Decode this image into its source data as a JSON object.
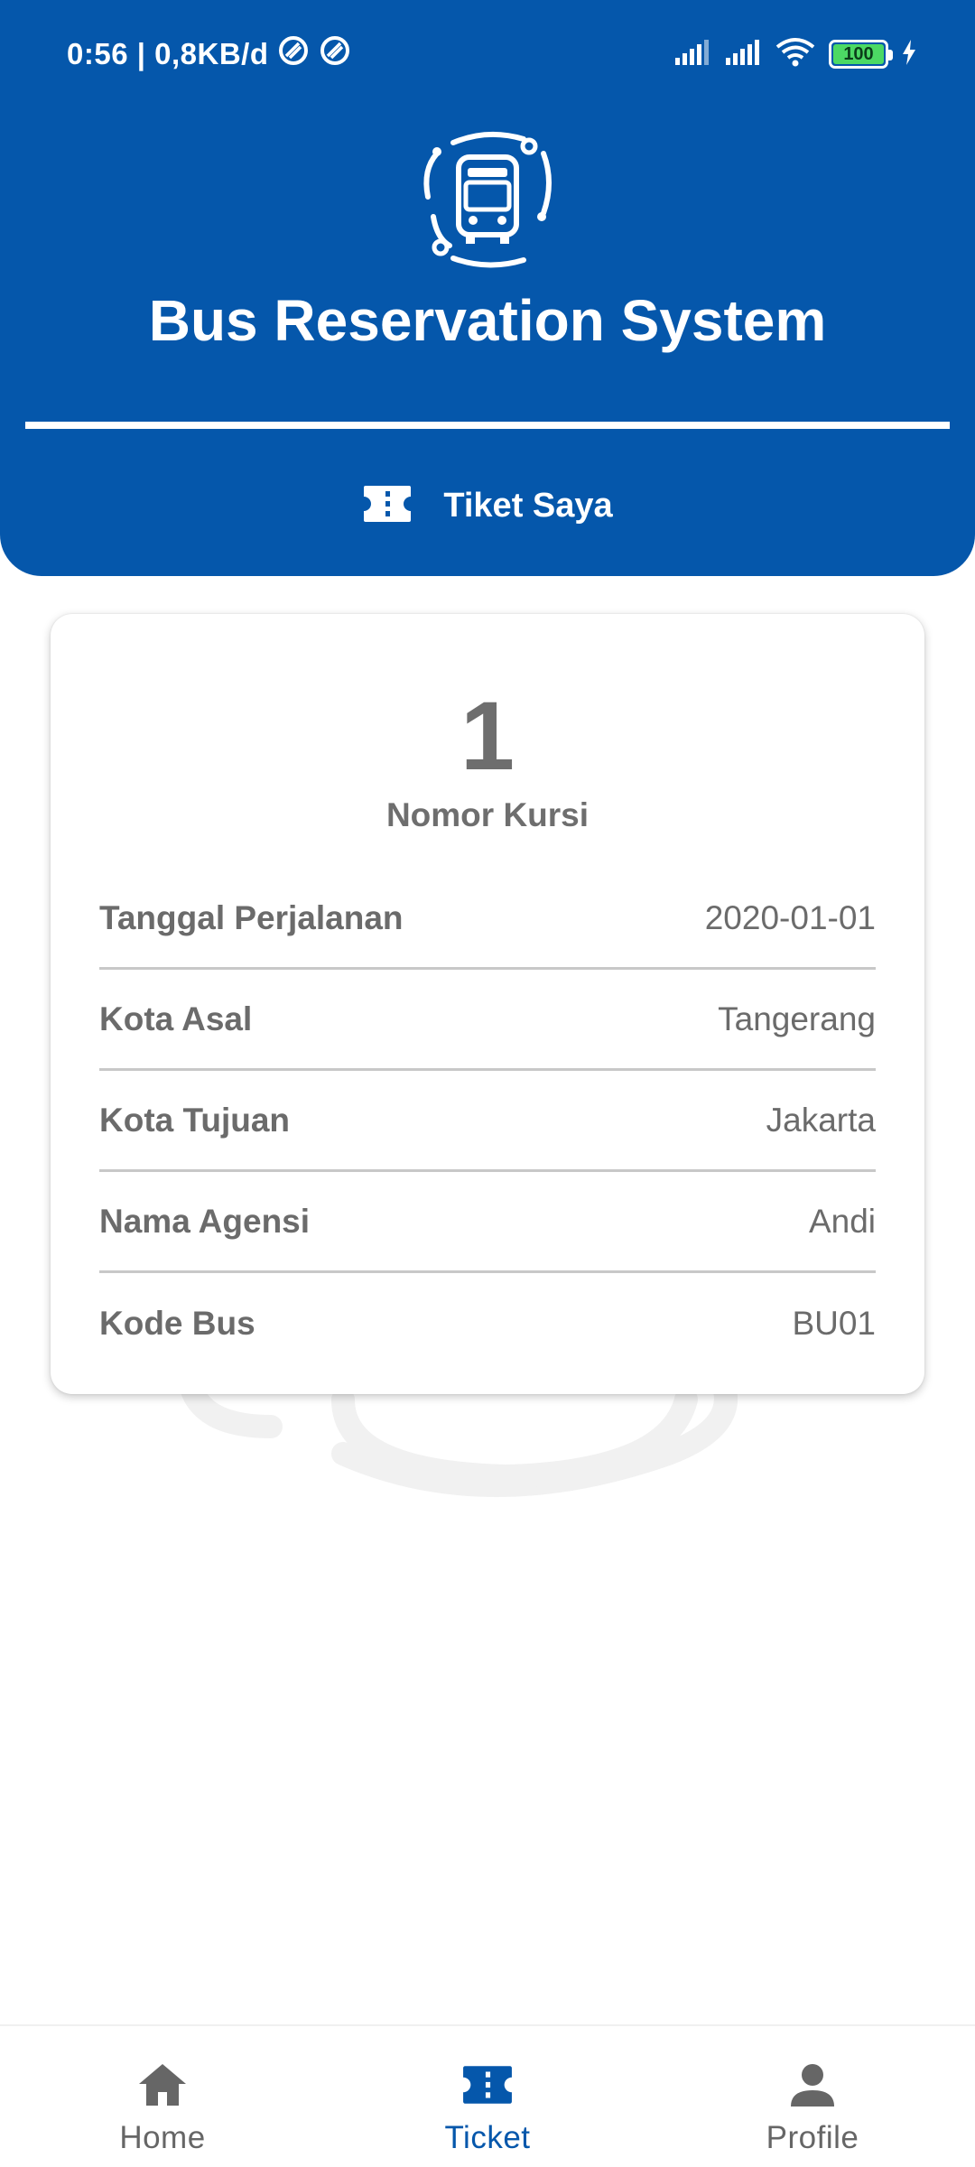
{
  "status_bar": {
    "time_speed": "0:56 | 0,8KB/d",
    "battery": "100"
  },
  "header": {
    "app_title": "Bus Reservation System",
    "section_label": "Tiket Saya"
  },
  "ticket": {
    "seat_number": "1",
    "seat_label": "Nomor Kursi",
    "rows": [
      {
        "label": "Tanggal Perjalanan",
        "value": "2020-01-01"
      },
      {
        "label": "Kota Asal",
        "value": "Tangerang"
      },
      {
        "label": "Kota Tujuan",
        "value": "Jakarta"
      },
      {
        "label": "Nama Agensi",
        "value": "Andi"
      },
      {
        "label": "Kode Bus",
        "value": "BU01"
      }
    ]
  },
  "bottom_nav": {
    "items": [
      {
        "label": "Home",
        "icon": "home-icon"
      },
      {
        "label": "Ticket",
        "icon": "ticket-icon",
        "active": true
      },
      {
        "label": "Profile",
        "icon": "person-icon"
      }
    ]
  },
  "colors": {
    "brand": "#0557ab",
    "text_muted": "#6e6e6e",
    "battery": "#4cd964"
  }
}
